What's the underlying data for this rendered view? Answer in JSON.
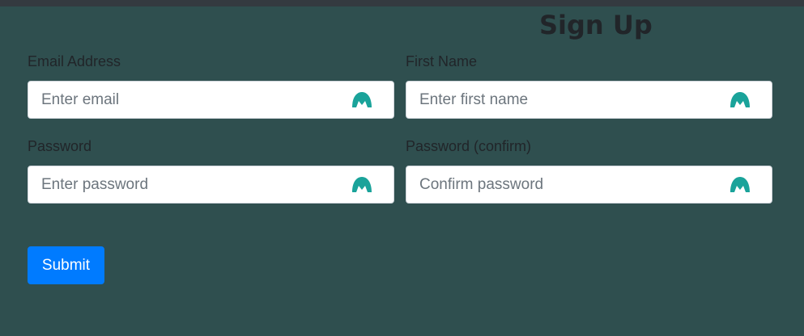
{
  "page": {
    "title": "Sign Up"
  },
  "form": {
    "fields": [
      {
        "label": "Email Address",
        "placeholder": "Enter email",
        "value": ""
      },
      {
        "label": "First Name",
        "placeholder": "Enter first name",
        "value": ""
      },
      {
        "label": "Password",
        "placeholder": "Enter password",
        "value": ""
      },
      {
        "label": "Password (confirm)",
        "placeholder": "Confirm password",
        "value": ""
      }
    ],
    "submit_label": "Submit"
  },
  "icons": {
    "field_icon": "password-manager-icon"
  },
  "colors": {
    "background": "#2f4f4f",
    "top_bar": "#343a40",
    "text": "#212529",
    "input_bg": "#ffffff",
    "input_border": "#ced4da",
    "placeholder": "#6c757d",
    "field_icon": "#1aa39a",
    "submit_bg": "#007bff",
    "submit_text": "#ffffff"
  }
}
